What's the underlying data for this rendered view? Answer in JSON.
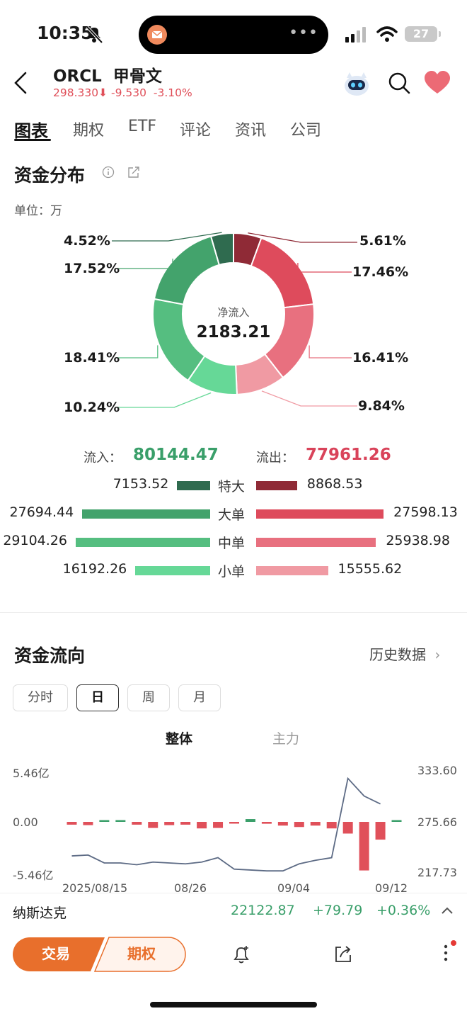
{
  "status": {
    "time": "10:35",
    "battery": "27"
  },
  "header": {
    "ticker": "ORCL",
    "name": "甲骨文",
    "price": "298.330",
    "change": "-9.530",
    "change_pct": "-3.10%"
  },
  "tabs": [
    "图表",
    "期权",
    "ETF",
    "评论",
    "资讯",
    "公司"
  ],
  "fund_dist": {
    "title": "资金分布",
    "unit": "单位：万",
    "center_label": "净流入",
    "center_value": "2183.21",
    "left_pcts": [
      "4.52%",
      "17.52%",
      "18.41%",
      "10.24%"
    ],
    "right_pcts": [
      "5.61%",
      "17.46%",
      "16.41%",
      "9.84%"
    ],
    "inflow_label": "流入：",
    "inflow_value": "80144.47",
    "outflow_label": "流出：",
    "outflow_value": "77961.26",
    "rows": [
      {
        "cat": "特大",
        "in": "7153.52",
        "out": "8868.53"
      },
      {
        "cat": "大单",
        "in": "27694.44",
        "out": "27598.13"
      },
      {
        "cat": "中单",
        "in": "29104.26",
        "out": "25938.98"
      },
      {
        "cat": "小单",
        "in": "16192.26",
        "out": "15555.62"
      }
    ],
    "colors": {
      "in": [
        "#2f6b4f",
        "#43a36c",
        "#55be80",
        "#66d897"
      ],
      "out": [
        "#8f2a36",
        "#de4b5c",
        "#e8707f",
        "#f09aa3"
      ]
    }
  },
  "fund_flow": {
    "title": "资金流向",
    "history": "历史数据",
    "periods": [
      "分时",
      "日",
      "周",
      "月"
    ],
    "segments": [
      "整体",
      "主力"
    ],
    "left_axis": [
      "5.46亿",
      "0.00",
      "-5.46亿"
    ],
    "right_axis": [
      "333.60",
      "275.66",
      "217.73"
    ],
    "dates": [
      "2025/08/15",
      "08/26",
      "09/04",
      "09/12"
    ]
  },
  "chart_data": {
    "type": "bar",
    "title": "",
    "xlabel": "",
    "ylabel": "",
    "ylim": [
      -5.46,
      5.46
    ],
    "y2lim": [
      217.73,
      333.6
    ],
    "series": [
      {
        "values": [
          -0.3,
          -0.35,
          0.1,
          0.08,
          -0.3,
          -0.65,
          -0.35,
          -0.3,
          -0.7,
          -0.65,
          -0.15,
          0.3,
          -0.2,
          -0.4,
          -0.55,
          -0.4,
          -0.7,
          -1.25,
          -5.2,
          -1.9,
          0.15
        ]
      },
      {
        "values": [
          237,
          238,
          229,
          229,
          227,
          230,
          229,
          228,
          230,
          235,
          222,
          221,
          220,
          220,
          228,
          232,
          235,
          325,
          305,
          296
        ]
      }
    ],
    "colors": {
      "positive": "#3a9f6a",
      "negative": "#e0505a",
      "line": "#5d6b85"
    }
  },
  "index": {
    "name": "纳斯达克",
    "value": "22122.87",
    "change": "+79.79",
    "pct": "+0.36%"
  },
  "toolbar": {
    "trade": "交易",
    "options": "期权"
  }
}
